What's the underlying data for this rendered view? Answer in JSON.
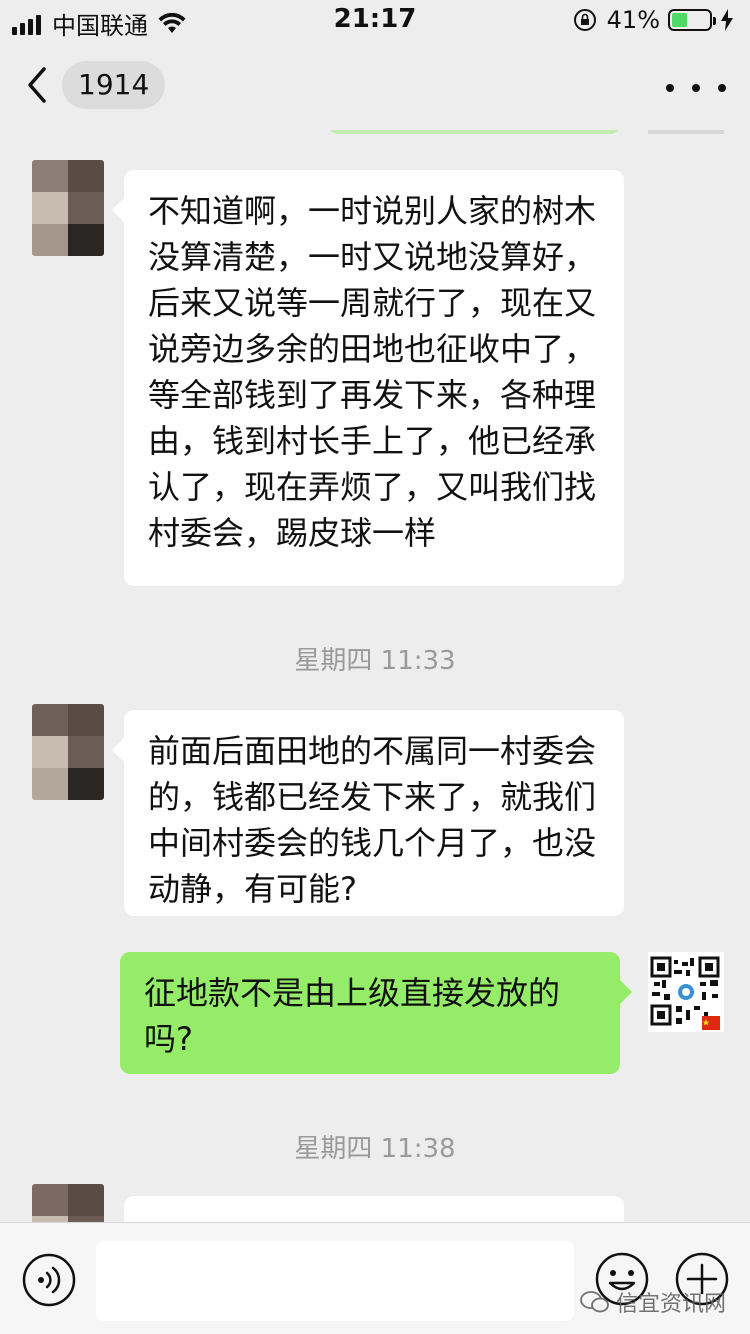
{
  "status_bar": {
    "carrier": "中国联通",
    "time": "21:17",
    "battery_percent": "41%",
    "battery_level": 0.41,
    "icons": [
      "signal-icon",
      "wifi-icon",
      "rotation-lock-icon",
      "battery-icon",
      "charging-icon"
    ]
  },
  "nav": {
    "back_icon": "chevron-left-icon",
    "unread_count": "1914",
    "more_icon": "more-dots-icon"
  },
  "messages": [
    {
      "side": "incoming",
      "text": "不知道啊，一时说别人家的树木没算清楚，一时又说地没算好，后来又说等一周就行了，现在又说旁边多余的田地也征收中了，等全部钱到了再发下来，各种理由，钱到村长手上了，他已经承认了，现在弄烦了，又叫我们找村委会，踢皮球一样"
    },
    {
      "side": "incoming",
      "text": "前面后面田地的不属同一村委会的，钱都已经发下来了，就我们中间村委会的钱几个月了，也没动静，有可能?"
    },
    {
      "side": "outgoing",
      "text": "征地款不是由上级直接发放的吗?"
    }
  ],
  "timestamps": [
    "星期四 11:33",
    "星期四 11:38"
  ],
  "input_bar": {
    "input_value": "",
    "icons": [
      "voice-icon",
      "emoji-icon",
      "plus-icon"
    ]
  },
  "watermark": {
    "text": "信宜资讯网",
    "icon": "wechat-logo-icon"
  },
  "colors": {
    "background": "#ededed",
    "incoming_bubble": "#ffffff",
    "outgoing_bubble": "#95ec69",
    "timestamp_text": "#9a9a9a",
    "battery_fill": "#4cd964"
  }
}
